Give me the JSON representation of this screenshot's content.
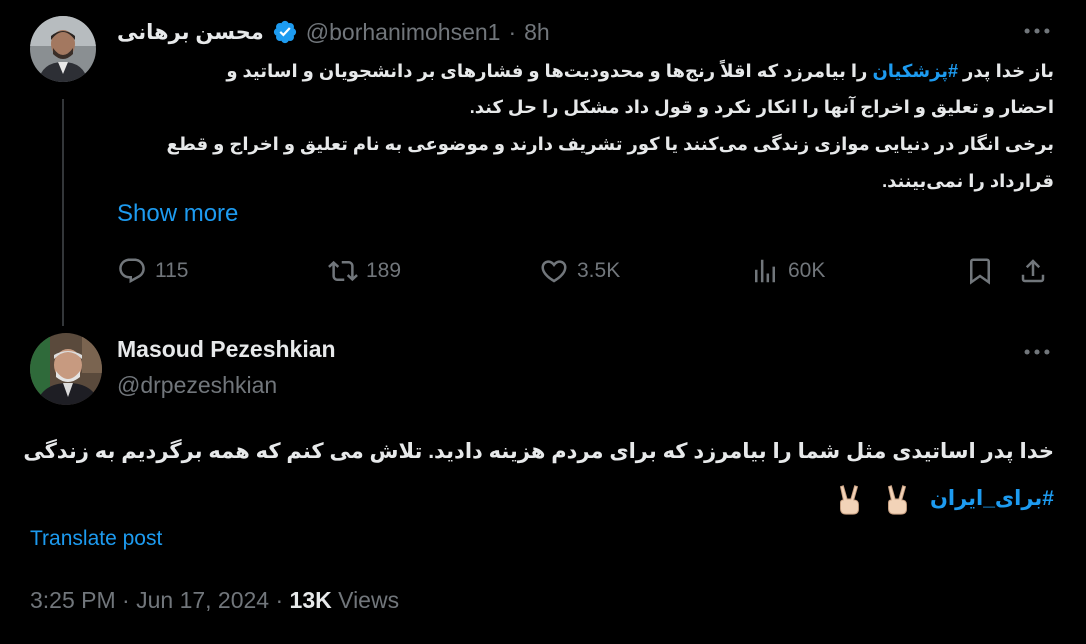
{
  "first_tweet": {
    "display_name": "محسن برهانی",
    "handle": "@borhanimohsen1",
    "separator": "·",
    "time": "8h",
    "line1_prefix": "باز خدا پدر ",
    "line1_hashtag": "#پزشکیان",
    "line1_suffix": " را بیامرزد که اقلاً رنج‌ها و محدودیت‌ها و فشارهای بر دانشجویان و اساتید و",
    "line2": "احضار و تعلیق و اخراج آنها را انکار نکرد و قول داد مشکل را حل کند.",
    "line3": "برخی انگار در دنیایی موازی زندگی می‌کنند یا کور تشریف دارند و موضوعی به نام تعلیق و اخراج و قطع",
    "line4": "قرارداد را نمی‌بینند.",
    "show_more": "Show more",
    "stats": {
      "replies": "115",
      "reposts": "189",
      "likes": "3.5K",
      "views": "60K"
    },
    "icons": {
      "verified": "verified-badge-icon",
      "more": "more-dots-icon",
      "reply": "reply-icon",
      "repost": "repost-icon",
      "like": "heart-icon",
      "views": "views-chart-icon",
      "bookmark": "bookmark-icon",
      "share": "share-icon"
    }
  },
  "main_tweet": {
    "display_name": "Masoud Pezeshkian",
    "handle": "@drpezeshkian",
    "body_line1": "خدا پدر اساتیدی مثل شما را بیامرزد که برای مردم هزینه دادید. تلاش می کنم که همه برگردیم به زندگی",
    "body_hashtag": "#برای_ایران",
    "emoji": "victory-hand-emoji",
    "translate": "Translate post",
    "timestamp": "3:25 PM · Jun 17, 2024 ·",
    "views_count": "13K",
    "views_label": "Views"
  },
  "colors": {
    "background": "#000000",
    "text": "#e7e9ea",
    "muted": "#71767b",
    "accent": "#1d9bf0"
  }
}
